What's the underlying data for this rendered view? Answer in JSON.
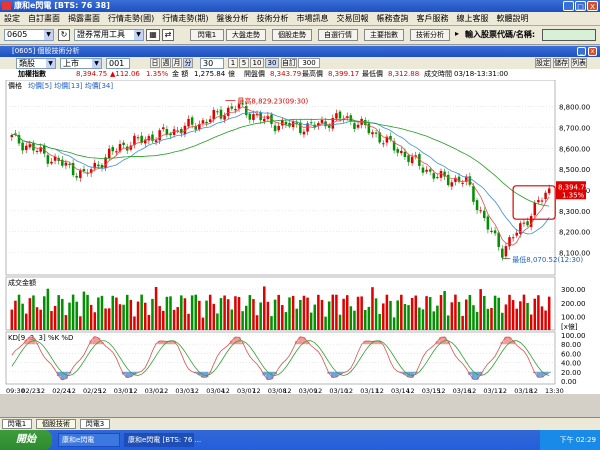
{
  "window": {
    "title": "康和e閃電 [BTS: 76 38]",
    "minimize": "_",
    "maximize": "□",
    "close": "X"
  },
  "menu": [
    "設定",
    "自訂畫面",
    "揭露畫面",
    "行情走勢(國)",
    "行情走勢(期)",
    "盤後分析",
    "技術分析",
    "市場訊息",
    "交易回報",
    "帳務查詢",
    "客戶服務",
    "線上客服",
    "軟體說明"
  ],
  "toolbar": {
    "stock_code": "0605",
    "tool_select": "證券常用工具",
    "buttons": [
      "閃電1",
      "大盤走勢",
      "個股走勢",
      "自選行情",
      "主要指數",
      "技術分析"
    ],
    "code_label": "輸入股票代碼/名稱:",
    "code_value": ""
  },
  "subwindow": {
    "title": "[0605] 個股技術分析"
  },
  "chart_tools": {
    "category": "類股",
    "market": "上市",
    "index_code": "001",
    "periods": [
      "日",
      "週",
      "月",
      "分"
    ],
    "interval_value": "30",
    "intervals": [
      "1",
      "5",
      "10",
      "30"
    ],
    "custom_label": "自訂",
    "custom_value": "300",
    "right_buttons": [
      "設定",
      "儲存",
      "列表"
    ]
  },
  "quote": {
    "name": "加權指數",
    "price": "8,394.75",
    "change": "▲112.06",
    "change_pct": "1.35%",
    "amount_label": "金 額",
    "amount": "1,275.84",
    "amount_unit": "億",
    "open_label": "開盤價",
    "open": "8,343.79",
    "high_label": "最高價",
    "high": "8,399.17",
    "low_label": "最低價",
    "low": "8,312.88",
    "time_label": "成交時間",
    "time": "03/18-13:31:00"
  },
  "price_panel": {
    "legend": "價格",
    "ma_legend": "均價[5]  均價[13]  均價[34]",
    "high_note": "最高8,829.23(09:30)",
    "low_note": "最低8,070.52(12:30)",
    "last_price_tag": "8,394.75",
    "last_pct_tag": "1.35%",
    "y_ticks": [
      "8,800.00",
      "8,700.00",
      "8,600.00",
      "8,500.00",
      "8,400.00",
      "8,300.00",
      "8,200.00",
      "8,100.00"
    ]
  },
  "volume_panel": {
    "legend": "成交金額",
    "y_ticks": [
      "300.00",
      "200.00",
      "100.00"
    ],
    "unit": "[x億]"
  },
  "kd_panel": {
    "legend": "KD[9, 3, 3] %K  %D",
    "y_ticks": [
      "100.00",
      "80.00",
      "60.00",
      "40.00",
      "20.00",
      "0.00"
    ]
  },
  "x_axis": {
    "labels": [
      "09:30",
      "02/23",
      "12",
      "02/24",
      "12",
      "02/25",
      "12",
      "03/01",
      "12",
      "03/02",
      "12",
      "03/03",
      "12",
      "03/04",
      "12",
      "03/07",
      "12",
      "03/08",
      "12",
      "03/09",
      "12",
      "03/10",
      "12",
      "03/11",
      "12",
      "03/14",
      "12",
      "03/15",
      "12",
      "03/16",
      "12",
      "03/17",
      "12",
      "03/18",
      "12",
      "13:30"
    ]
  },
  "colors": {
    "up": "#e00000",
    "down": "#009000",
    "ma5": "#e05050",
    "ma13": "#3a8fe0",
    "ma34": "#20a020",
    "k": "#e05050",
    "d": "#30a030"
  },
  "bottom_tabs": [
    "閃電1",
    "個股技術",
    "閃電3"
  ],
  "taskbar": {
    "start": "開始",
    "items": [
      "康和e閃電",
      "康和e閃電 [BTS: 76 ..."
    ],
    "clock": "下午 02:29"
  }
}
